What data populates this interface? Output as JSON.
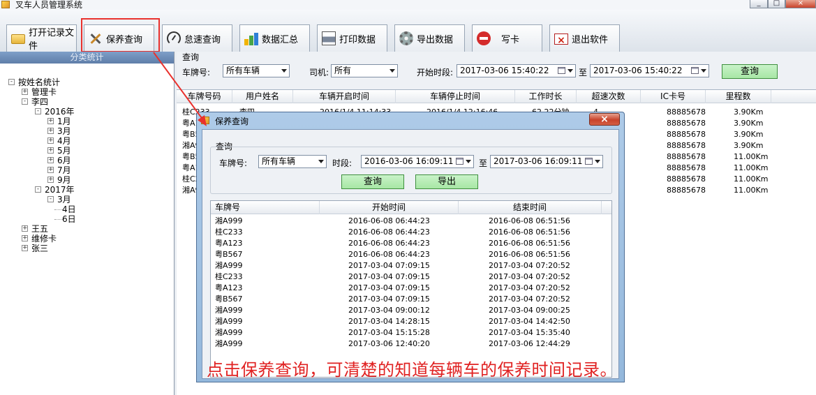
{
  "app": {
    "title": "叉车人员管理系统"
  },
  "window_controls": [
    "_",
    "□",
    "×"
  ],
  "toolbar": {
    "buttons": [
      {
        "label": "打开记录文件",
        "icon": "folder-icon"
      },
      {
        "label": "保养查询",
        "icon": "tools-icon"
      },
      {
        "label": "怠速查询",
        "icon": "gauge-icon"
      },
      {
        "label": "数据汇总",
        "icon": "bar-chart-icon"
      },
      {
        "label": "打印数据",
        "icon": "printer-icon"
      },
      {
        "label": "导出数据",
        "icon": "gear-icon"
      },
      {
        "label": "写卡",
        "icon": "no-entry-icon"
      },
      {
        "label": "退出软件",
        "icon": "exit-icon"
      }
    ]
  },
  "sidebar": {
    "header": "分类统计",
    "tree": [
      {
        "label": "按姓名统计",
        "sign": "-"
      },
      {
        "label": "管理卡",
        "sign": "+"
      },
      {
        "label": "李四",
        "sign": "-"
      },
      {
        "label": "2016年",
        "sign": "-"
      },
      {
        "label": "1月",
        "sign": "+"
      },
      {
        "label": "3月",
        "sign": "+"
      },
      {
        "label": "4月",
        "sign": "+"
      },
      {
        "label": "5月",
        "sign": "+"
      },
      {
        "label": "6月",
        "sign": "+"
      },
      {
        "label": "7月",
        "sign": "+"
      },
      {
        "label": "9月",
        "sign": "+"
      },
      {
        "label": "2017年",
        "sign": "-"
      },
      {
        "label": "3月",
        "sign": "-"
      },
      {
        "label": "4日",
        "sign": ""
      },
      {
        "label": "6日",
        "sign": ""
      },
      {
        "label": "王五",
        "sign": "+"
      },
      {
        "label": "维修卡",
        "sign": "+"
      },
      {
        "label": "张三",
        "sign": "+"
      }
    ]
  },
  "query": {
    "title": "查询",
    "plate_label": "车牌号:",
    "plate_value": "所有车辆",
    "driver_label": "司机:",
    "driver_value": "所有",
    "start_label": "开始时段:",
    "start_value": "2017-03-06 15:40:22",
    "to_label": "至",
    "end_value": "2017-03-06 15:40:22",
    "search_btn": "查询"
  },
  "main_grid": {
    "columns": [
      "车牌号码",
      "用户姓名",
      "车辆开启时间",
      "车辆停止时间",
      "工作时长",
      "超速次数",
      "IC卡号",
      "里程数"
    ],
    "rows": [
      [
        "桂C233",
        "李四",
        "2016/1/4 11:14:33",
        "2016/1/4 12:16:46",
        "62.22分钟",
        "4",
        "88885678",
        "3.90Km"
      ],
      [
        "粤A123",
        "",
        "",
        "",
        "",
        "",
        "88885678",
        "3.90Km"
      ],
      [
        "粤B567",
        "",
        "",
        "",
        "",
        "",
        "88885678",
        "3.90Km"
      ],
      [
        "湘A999",
        "",
        "",
        "",
        "",
        "",
        "88885678",
        "3.90Km"
      ],
      [
        "粤B567",
        "",
        "",
        "",
        "",
        "",
        "88885678",
        "11.00Km"
      ],
      [
        "粤A123",
        "",
        "",
        "",
        "",
        "",
        "88885678",
        "11.00Km"
      ],
      [
        "桂C233",
        "",
        "",
        "",
        "",
        "",
        "88885678",
        "11.00Km"
      ],
      [
        "湘A999",
        "",
        "",
        "",
        "",
        "",
        "88885678",
        "11.00Km"
      ]
    ]
  },
  "dialog": {
    "title": "保养查询",
    "close": "×",
    "group_title": "查询",
    "plate_label": "车牌号:",
    "plate_value": "所有车辆",
    "period_label": "时段:",
    "start_value": "2016-03-06 16:09:11",
    "to_label": "至",
    "end_value": "2017-03-06 16:09:11",
    "search_btn": "查询",
    "export_btn": "导出",
    "columns": [
      "车牌号",
      "开始时间",
      "结束时间"
    ],
    "rows": [
      [
        "湘A999",
        "2016-06-08 06:44:23",
        "2016-06-08 06:51:56"
      ],
      [
        "桂C233",
        "2016-06-08 06:44:23",
        "2016-06-08 06:51:56"
      ],
      [
        "粤A123",
        "2016-06-08 06:44:23",
        "2016-06-08 06:51:56"
      ],
      [
        "粤B567",
        "2016-06-08 06:44:23",
        "2016-06-08 06:51:56"
      ],
      [
        "湘A999",
        "2017-03-04 07:09:15",
        "2017-03-04 07:20:52"
      ],
      [
        "桂C233",
        "2017-03-04 07:09:15",
        "2017-03-04 07:20:52"
      ],
      [
        "粤A123",
        "2017-03-04 07:09:15",
        "2017-03-04 07:20:52"
      ],
      [
        "粤B567",
        "2017-03-04 07:09:15",
        "2017-03-04 07:20:52"
      ],
      [
        "湘A999",
        "2017-03-04 09:00:12",
        "2017-03-04 09:00:25"
      ],
      [
        "湘A999",
        "2017-03-04 14:28:15",
        "2017-03-04 14:42:50"
      ],
      [
        "湘A999",
        "2017-03-04 15:15:28",
        "2017-03-04 15:35:40"
      ],
      [
        "湘A999",
        "2017-03-06 12:40:20",
        "2017-03-06 12:44:29"
      ]
    ]
  },
  "annotation": {
    "caption": "点击保养查询，可清楚的知道每辆车的保养时间记录。",
    "color": "#e02222"
  }
}
